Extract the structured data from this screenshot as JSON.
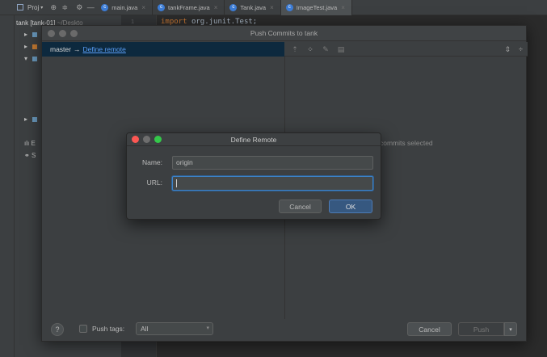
{
  "ide": {
    "project_label": "Proj",
    "tabs": [
      {
        "label": "main.java"
      },
      {
        "label": "tankFrame.java"
      },
      {
        "label": "Tank.java"
      },
      {
        "label": "ImageTest.java"
      }
    ],
    "project_root": "tank [tank-01]",
    "project_path": "~/Deskto",
    "line_number": "1",
    "code_keyword": "import",
    "code_package": "org.junit.Test;",
    "tree_labels": [
      "E",
      "S"
    ]
  },
  "push_dialog": {
    "title": "Push Commits to tank",
    "branch": "master",
    "arrow": "→",
    "remote_link": "Define remote",
    "no_commits_text": "commits selected",
    "push_tags_label": "Push tags:",
    "push_tags_value": "All",
    "help_label": "?",
    "cancel_label": "Cancel",
    "push_label": "Push"
  },
  "define_remote": {
    "title": "Define Remote",
    "name_label": "Name:",
    "name_value": "origin",
    "url_label": "URL:",
    "url_value": "",
    "cancel_label": "Cancel",
    "ok_label": "OK"
  },
  "colors": {
    "accent": "#365880",
    "link": "#589df6",
    "selected_row": "#0d293e",
    "close_light": "#fc5753",
    "zoom_light": "#34c84a"
  }
}
